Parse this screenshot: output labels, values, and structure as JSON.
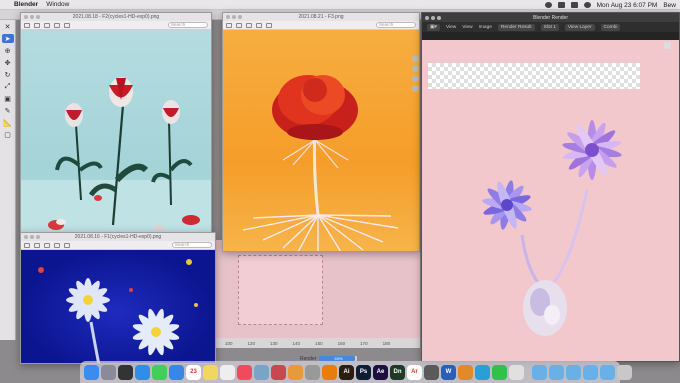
{
  "menubar": {
    "app_name": "Blender",
    "window_menu": "Window",
    "clock": "Mon Aug 23  6:07 PM",
    "user": "Bew"
  },
  "windows": {
    "tulips": {
      "title": "2021.08.18 - F2(cycles1-HD-exp0).png",
      "search": "Search"
    },
    "rose": {
      "title": "2021.08.21 - F3.png",
      "search": "Search"
    },
    "daisies": {
      "title": "2021.08.16 - F1(cycles1-HD-exp0).png",
      "search": "Search"
    },
    "render": {
      "title": "Blender Render",
      "view_menu": "View",
      "image_menu": "Image",
      "render_result": "Render Result",
      "slot": "Slot 1",
      "view_layer": "View Layer",
      "combined": "Combi"
    }
  },
  "timeline": {
    "ticks": [
      "100",
      "120",
      "130",
      "140",
      "150",
      "160",
      "170",
      "180"
    ]
  },
  "status": {
    "label": "Render",
    "progress_text": "93%",
    "progress": 0.93
  },
  "dock": {
    "apps": [
      {
        "icon": "finder-icon",
        "color": "#3b8cf0",
        "text": ""
      },
      {
        "icon": "launchpad-icon",
        "color": "#8a8a9a",
        "text": ""
      },
      {
        "icon": "mission-control-icon",
        "color": "#333",
        "text": ""
      },
      {
        "icon": "safari-icon",
        "color": "#2f8fe8",
        "text": ""
      },
      {
        "icon": "messages-icon",
        "color": "#3fcf5a",
        "text": ""
      },
      {
        "icon": "mail-icon",
        "color": "#3a86e6",
        "text": ""
      },
      {
        "icon": "calendar-icon",
        "color": "#ffffff",
        "text": "23"
      },
      {
        "icon": "notes-icon",
        "color": "#f0d860",
        "text": ""
      },
      {
        "icon": "reminders-icon",
        "color": "#eeeeee",
        "text": ""
      },
      {
        "icon": "music-icon",
        "color": "#f04a5c",
        "text": ""
      },
      {
        "icon": "preview-icon",
        "color": "#7aa3c8",
        "text": ""
      },
      {
        "icon": "photo-icon",
        "color": "#c94850",
        "text": ""
      },
      {
        "icon": "photos-icon",
        "color": "#e89a3a",
        "text": ""
      },
      {
        "icon": "app-icon",
        "color": "#999",
        "text": ""
      },
      {
        "icon": "blender-icon",
        "color": "#e87d0d",
        "text": ""
      },
      {
        "icon": "illustrator-icon",
        "color": "#2b1d0f",
        "text": "Ai"
      },
      {
        "icon": "photoshop-icon",
        "color": "#0e1c36",
        "text": "Ps"
      },
      {
        "icon": "after-effects-icon",
        "color": "#1c0f3d",
        "text": "Ae"
      },
      {
        "icon": "dimension-icon",
        "color": "#1e3a24",
        "text": "Dn"
      },
      {
        "icon": "acrobat-icon",
        "color": "#ffffff",
        "text": "Ar"
      },
      {
        "icon": "app-icon-2",
        "color": "#5a5a5a",
        "text": ""
      },
      {
        "icon": "word-icon",
        "color": "#2a5eb8",
        "text": "W"
      },
      {
        "icon": "app-icon-3",
        "color": "#e08a2a",
        "text": ""
      },
      {
        "icon": "app-icon-4",
        "color": "#2a9ed8",
        "text": ""
      },
      {
        "icon": "line-icon",
        "color": "#2fc14a",
        "text": ""
      },
      {
        "icon": "app-icon-5",
        "color": "#e0e0e0",
        "text": ""
      },
      {
        "icon": "folder-icon",
        "color": "#6ab0e8",
        "text": ""
      },
      {
        "icon": "folder-icon-2",
        "color": "#6ab0e8",
        "text": ""
      },
      {
        "icon": "folder-icon-3",
        "color": "#6ab0e8",
        "text": ""
      },
      {
        "icon": "folder-icon-4",
        "color": "#6ab0e8",
        "text": ""
      },
      {
        "icon": "folder-icon-5",
        "color": "#6ab0e8",
        "text": ""
      },
      {
        "icon": "trash-icon",
        "color": "#c8c8c8",
        "text": ""
      }
    ]
  },
  "colors": {
    "accent": "#3a76d8",
    "render_bg": "#f2c8cd",
    "tulip_bg": "#a4d3d8",
    "rose_bg": "#f59d2a",
    "daisy_bg": "#0c1590"
  }
}
